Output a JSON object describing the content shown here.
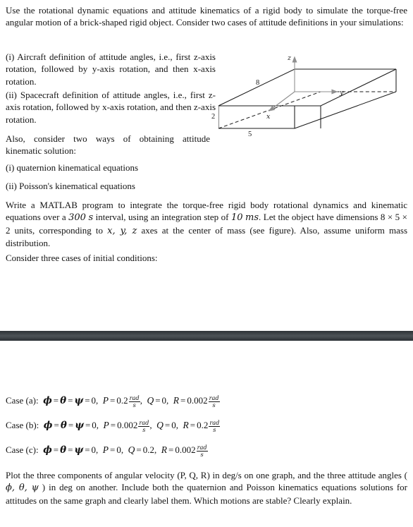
{
  "document": {
    "paragraphs": {
      "intro": "Use the rotational dynamic equations and attitude kinematics of a rigid body to simulate the torque-free angular motion of a brick-shaped rigid object. Consider two cases of attitude definitions in your simulations:",
      "item_aircraft": "(i) Aircraft definition of attitude angles, i.e., first z-axis rotation, followed by y-axis rotation, and then x-axis rotation.",
      "item_spacecraft": "(ii) Spacecraft definition of attitude angles, i.e., first z-axis rotation, followed by x-axis rotation, and then z-axis rotation.",
      "also_intro": "Also, consider two ways of obtaining attitude kinematic solution:",
      "item_quaternion": "(i) quaternion kinematical equations",
      "item_poisson": "(ii) Poisson's kinematical equations",
      "matlab": "Write a MATLAB program to integrate the torque-free rigid body rotational dynamics and kinematic equations over a 300 s interval, using an integration step of 10 ms. Let the object have dimensions 8 × 5 × 2 units, corresponding to x, y, z axes at the center of mass (see figure). Also, assume uniform mass distribution.",
      "consider": "Consider three cases of initial conditions:",
      "plot": "Plot the three components of angular velocity (P, Q, R) in deg/s on one graph, and the three attitude angles ( ϕ, θ, ψ ) in deg on another. Include both the quaternion and Poisson kinematics equations solutions for attitudes on the same graph and clearly label them. Which motions are stable? Clearly explain."
    },
    "matlab_parts": {
      "a": "Write a MATLAB program to integrate the torque-free rigid body rotational dynamics and kinematic equations over a ",
      "interval_value": "300",
      "interval_unit": "s",
      "b": " interval, using an integration step of ",
      "step_value": "10",
      "step_unit": "ms",
      "c": ". Let the object have dimensions ",
      "dims": "8 × 5 × 2",
      "d": " units, corresponding to ",
      "axes": "x, y, z",
      "e": " axes at the center of mass (see figure). Also, assume uniform mass distribution."
    },
    "plot_parts": {
      "a": "Plot the three components of angular velocity (P, Q, R) in deg/s on one graph, and the three attitude angles ( ",
      "angles": "ϕ, θ, ψ",
      "b": " ) in deg on another. Include both the quaternion and Poisson kinematics equations solutions for attitudes on the same graph and clearly label them. Which motions are stable? Clearly explain."
    },
    "figure": {
      "label_length": "8",
      "label_width": "5",
      "label_height": "2",
      "axis_x": "x",
      "axis_y": "y",
      "axis_z": "z",
      "line_color": "#1a1a1a",
      "axis_color": "#8a8a8a"
    },
    "separator": {
      "color": "#41474b"
    },
    "cases": [
      {
        "label": "Case (a):",
        "phi": "ϕ",
        "theta": "θ",
        "psi": "ψ",
        "angles_value": "0",
        "P_sym": "P",
        "P_value": "0.2",
        "P_unit_num": "rad",
        "P_unit_den": "s",
        "P_has_unit": true,
        "Q_sym": "Q",
        "Q_value": "0",
        "Q_has_unit": false,
        "R_sym": "R",
        "R_value": "0.002",
        "R_unit_num": "rad",
        "R_unit_den": "s",
        "R_has_unit": true
      },
      {
        "label": "Case (b):",
        "phi": "ϕ",
        "theta": "θ",
        "psi": "ψ",
        "angles_value": "0",
        "P_sym": "P",
        "P_value": "0.002",
        "P_unit_num": "rad",
        "P_unit_den": "s",
        "P_has_unit": true,
        "Q_sym": "Q",
        "Q_value": "0",
        "Q_has_unit": false,
        "R_sym": "R",
        "R_value": "0.2",
        "R_unit_num": "rad",
        "R_unit_den": "s",
        "R_has_unit": true
      },
      {
        "label": "Case (c):",
        "phi": "ϕ",
        "theta": "θ",
        "psi": "ψ",
        "angles_value": "0",
        "P_sym": "P",
        "P_value": "0",
        "P_has_unit": false,
        "Q_sym": "Q",
        "Q_value": "0.2",
        "Q_has_unit": false,
        "R_sym": "R",
        "R_value": "0.002",
        "R_unit_num": "rad",
        "R_unit_den": "s",
        "R_has_unit": true
      }
    ]
  }
}
